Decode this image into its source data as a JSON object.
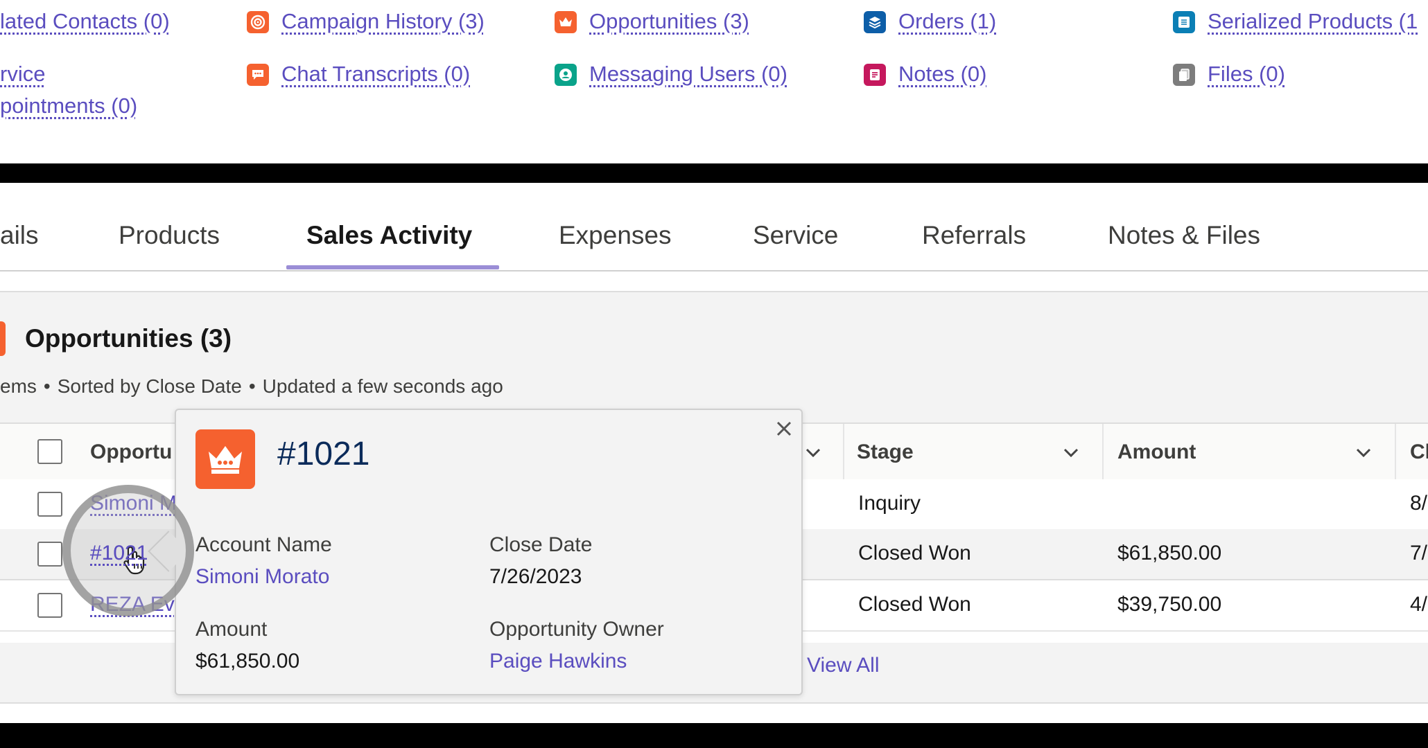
{
  "related_links": [
    {
      "label": "lated Contacts (0)",
      "icon": "none"
    },
    {
      "label": "Campaign History (3)",
      "icon": "campaign-icon",
      "color": "#f5612f"
    },
    {
      "label": "Opportunities (3)",
      "icon": "crown-icon",
      "color": "#f5612f"
    },
    {
      "label": "Orders (1)",
      "icon": "orders-icon",
      "color": "#0d5ea8"
    },
    {
      "label": "Serialized Products (1",
      "icon": "serialized-products-icon",
      "color": "#0b7fb5"
    },
    {
      "label": "rvice\npointments (0)",
      "icon": "none"
    },
    {
      "label": "Chat Transcripts (0)",
      "icon": "chat-icon",
      "color": "#f5612f"
    },
    {
      "label": "Messaging Users (0)",
      "icon": "messaging-user-icon",
      "color": "#0aa38a"
    },
    {
      "label": "Notes (0)",
      "icon": "notes-icon",
      "color": "#c5185d"
    },
    {
      "label": "Files (0)",
      "icon": "files-icon",
      "color": "#7d7d7d"
    }
  ],
  "tabs": [
    {
      "label": "ails",
      "active": false
    },
    {
      "label": "Products",
      "active": false
    },
    {
      "label": "Sales Activity",
      "active": true
    },
    {
      "label": "Expenses",
      "active": false
    },
    {
      "label": "Service",
      "active": false
    },
    {
      "label": "Referrals",
      "active": false
    },
    {
      "label": "Notes & Files",
      "active": false
    }
  ],
  "card": {
    "title": "Opportunities (3)",
    "meta": [
      "ems",
      "•",
      "Sorted by Close Date",
      "•",
      "Updated a few seconds ago"
    ],
    "view_all": "View All"
  },
  "table": {
    "columns": {
      "name": "Opportu",
      "stage": "Stage",
      "amount": "Amount",
      "close": "Cl"
    },
    "rows": [
      {
        "name": "Simoni M",
        "stage": "Inquiry",
        "amount": "",
        "close": "8/"
      },
      {
        "name": "#1021",
        "stage": "Closed Won",
        "amount": "$61,850.00",
        "close": "7/"
      },
      {
        "name": "REZA Ev",
        "stage": "Closed Won",
        "amount": "$39,750.00",
        "close": "4/"
      }
    ]
  },
  "popover": {
    "title": "#1021",
    "fields": {
      "account_name_label": "Account Name",
      "account_name_value": "Simoni Morato",
      "close_date_label": "Close Date",
      "close_date_value": "7/26/2023",
      "amount_label": "Amount",
      "amount_value": "$61,850.00",
      "owner_label": "Opportunity Owner",
      "owner_value": "Paige Hawkins"
    }
  },
  "colors": {
    "link": "#5a4dbf",
    "accent_orange": "#f5612f",
    "tab_underline": "#9b8ed6",
    "title_navy": "#0b2b5a"
  }
}
